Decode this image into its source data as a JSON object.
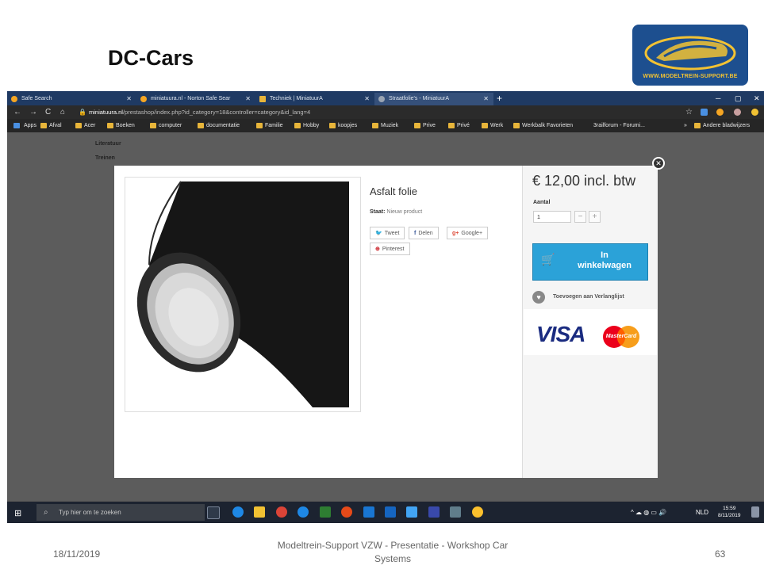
{
  "slide": {
    "title": "DC-Cars",
    "logo_text": "WWW.MODELTREIN-SUPPORT.BE",
    "footer_date": "18/11/2019",
    "footer_center": "Modeltrein-Support  VZW - Presentatie - Workshop  Car Systems",
    "page_number": "63"
  },
  "browser": {
    "tabs": [
      {
        "label": "Safe Search",
        "icon_color": "#f5a623",
        "active": false
      },
      {
        "label": "miniatuura.nl - Norton Safe Sear",
        "icon_color": "#f5a623",
        "active": false
      },
      {
        "label": "Techniek | MiniatuurA",
        "icon_color": "#e8b53a",
        "active": false
      },
      {
        "label": "Straatfolie's - MiniatuurA",
        "icon_color": "#9aa4b2",
        "active": true
      }
    ],
    "new_tab": "+",
    "url_domain": "miniatuura.nl",
    "url_path": "/prestashop/index.php?id_category=18&controller=category&id_lang=4",
    "bookmarks": [
      "Apps",
      "Afval",
      "Acer",
      "Boeken",
      "computer",
      "documentatie",
      "Familie",
      "Hobby",
      "koopjes",
      "Muziek",
      "Prive",
      "Privé",
      "Werk",
      "Werkbalk Favorieten",
      "3railforum - Forumi..."
    ],
    "other_bookmarks": "Andere bladwijzers",
    "nav": {
      "back": "←",
      "forward": "→",
      "reload": "C",
      "home": "⌂",
      "more": "»",
      "star": "☆"
    },
    "window_controls": {
      "minimize": "─",
      "maximize": "▢",
      "close": "✕"
    }
  },
  "page": {
    "sidebar_items": [
      "Literatuur",
      "Treinen"
    ]
  },
  "modal": {
    "product_name": "Asfalt folie",
    "condition_label": "Staat:",
    "condition_value": "Nieuw product",
    "share_buttons": [
      {
        "label": "Tweet",
        "icon": "twitter-icon",
        "glyph": "🐦",
        "color": "#1da1f2"
      },
      {
        "label": "Delen",
        "icon": "facebook-icon",
        "glyph": "f",
        "color": "#3b5998"
      },
      {
        "label": "Google+",
        "icon": "google-plus-icon",
        "glyph": "g+",
        "color": "#dd4b39"
      },
      {
        "label": "Pinterest",
        "icon": "pinterest-icon",
        "glyph": "⊕",
        "color": "#cb2027"
      }
    ],
    "price": "€ 12,00 incl. btw",
    "quantity_label": "Aantal",
    "quantity_value": "1",
    "qty_minus": "−",
    "qty_plus": "+",
    "cart_button_label_line1": "In",
    "cart_button_label_line2": "winkelwagen",
    "wishlist_label": "Toevoegen aan Verlanglijst",
    "payment_visa": "VISA",
    "payment_mastercard": "MasterCard",
    "close_glyph": "✕"
  },
  "taskbar": {
    "search_placeholder": "Typ hier om te zoeken",
    "tray_text": "NLD",
    "clock_time": "15:59",
    "clock_date": "8/11/2019"
  },
  "colors": {
    "accent_blue": "#2ba2d8",
    "tabbar": "#1f3a63",
    "taskbar": "#1c2330"
  }
}
